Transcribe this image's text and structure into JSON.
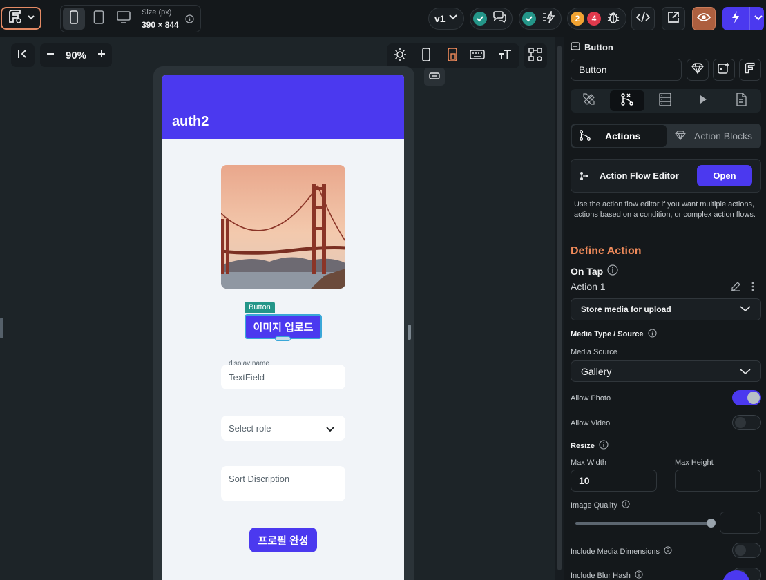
{
  "topbar": {
    "size_label": "Size (px)",
    "size_value": "390 × 844",
    "version": "v1",
    "warning_count": "2",
    "error_count": "4"
  },
  "canvas": {
    "zoom": "90%"
  },
  "phone": {
    "appbar_title": "auth2",
    "button_tag": "Button",
    "upload_button": "이미지 업로드",
    "textfield_label": "display name",
    "textfield_value": "TextField",
    "dropdown_value": "Select role",
    "description_value": "Sort Discription",
    "submit_button": "프로필 완성"
  },
  "panel": {
    "widget_type": "Button",
    "widget_name": "Button",
    "tab_actions": "Actions",
    "tab_action_blocks": "Action Blocks",
    "flow_editor_label": "Action Flow Editor",
    "open_label": "Open",
    "help_text": "Use the action flow editor if you want multiple actions, actions based on a condition, or complex action flows.",
    "define_action": "Define Action",
    "on_tap": "On Tap",
    "action_name": "Action 1",
    "action_type": "Store media for upload",
    "media_type_label": "Media Type / Source",
    "media_source_label": "Media Source",
    "media_source_value": "Gallery",
    "allow_photo_label": "Allow Photo",
    "allow_photo": true,
    "allow_video_label": "Allow Video",
    "allow_video": false,
    "resize_label": "Resize",
    "max_width_label": "Max Width",
    "max_width_value": "10",
    "max_height_label": "Max Height",
    "max_height_value": "",
    "image_quality_label": "Image Quality",
    "image_quality_value": "",
    "include_dims_label": "Include Media Dimensions",
    "include_dims": false,
    "include_blur_label": "Include Blur Hash"
  },
  "colors": {
    "accent": "#4b39ef",
    "define_action": "#ef8a5a",
    "success": "#249689",
    "warning": "#f1a332",
    "error": "#e0394c"
  }
}
